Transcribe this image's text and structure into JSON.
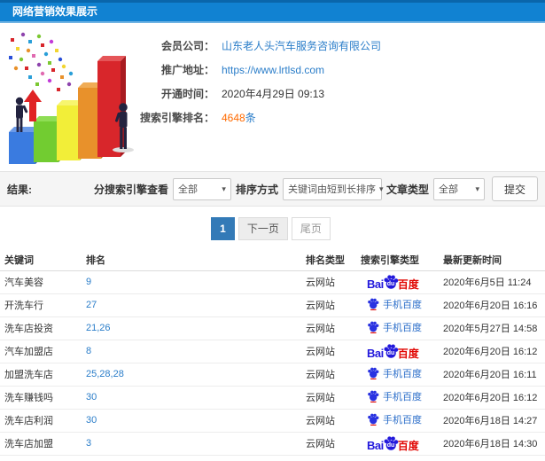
{
  "header": {
    "title": "网络营销效果展示"
  },
  "info": {
    "rows": [
      {
        "label": "会员公司：",
        "value": "山东老人头汽车服务咨询有限公司"
      },
      {
        "label": "推广地址：",
        "value": "https://www.lrtlsd.com"
      },
      {
        "label": "开通时间：",
        "value": "2020年4月29日 09:13"
      },
      {
        "label": "搜索引擎排名：",
        "value": "4648",
        "suffix": "条"
      }
    ]
  },
  "filters": {
    "section_label": "结果:",
    "engine_view_label": "分搜索引擎查看",
    "engine_view_value": "全部",
    "sort_label": "排序方式",
    "sort_value": "关键词由短到长排序",
    "article_type_label": "文章类型",
    "article_type_value": "全部",
    "submit_label": "提交",
    "caret": "▾"
  },
  "pagination": {
    "current": "1",
    "next": "下一页",
    "last": "尾页"
  },
  "table": {
    "headers": [
      "关键词",
      "排名",
      "排名类型",
      "搜索引擎类型",
      "最新更新时间"
    ],
    "engine_labels": {
      "baidu": {
        "bai": "Bai",
        "du": "du",
        "cn": "百度"
      },
      "mobile": "手机百度"
    },
    "rows": [
      {
        "keyword": "汽车美容",
        "rank": "9",
        "rank_type": "云网站",
        "engine": "baidu",
        "updated": "2020年6月5日 11:24"
      },
      {
        "keyword": "开洗车行",
        "rank": "27",
        "rank_type": "云网站",
        "engine": "mobile",
        "updated": "2020年6月20日 16:16"
      },
      {
        "keyword": "洗车店投资",
        "rank": "21,26",
        "rank_type": "云网站",
        "engine": "mobile",
        "updated": "2020年5月27日 14:58"
      },
      {
        "keyword": "汽车加盟店",
        "rank": "8",
        "rank_type": "云网站",
        "engine": "baidu",
        "updated": "2020年6月20日 16:12"
      },
      {
        "keyword": "加盟洗车店",
        "rank": "25,28,28",
        "rank_type": "云网站",
        "engine": "mobile",
        "updated": "2020年6月20日 16:11"
      },
      {
        "keyword": "洗车赚钱吗",
        "rank": "30",
        "rank_type": "云网站",
        "engine": "mobile",
        "updated": "2020年6月20日 16:12"
      },
      {
        "keyword": "洗车店利润",
        "rank": "30",
        "rank_type": "云网站",
        "engine": "mobile",
        "updated": "2020年6月18日 14:27"
      },
      {
        "keyword": "洗车店加盟",
        "rank": "3",
        "rank_type": "云网站",
        "engine": "baidu",
        "updated": "2020年6月18日 14:30"
      }
    ]
  },
  "colors": {
    "header_blue": "#1182d2",
    "link_blue": "#2a7dc9",
    "rank_orange": "#ff6a00",
    "baidu_blue": "#2319dc",
    "baidu_red": "#e10602",
    "pagination_active": "#337ab7"
  }
}
